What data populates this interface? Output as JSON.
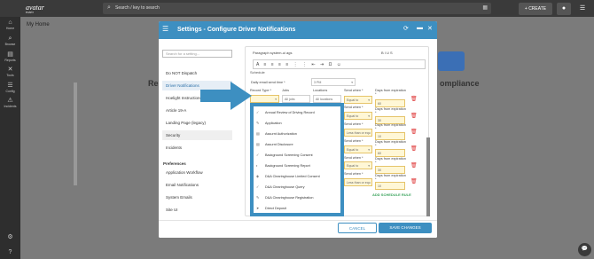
{
  "header": {
    "logo": "avatar",
    "logo_sub": "FLEET",
    "search_placeholder": "Search / key to search",
    "create_label": "+ CREATE"
  },
  "leftnav": [
    {
      "label": "Home",
      "icon": "⌂"
    },
    {
      "label": "Browse",
      "icon": "⌕"
    },
    {
      "label": "Reports",
      "icon": "▤"
    },
    {
      "label": "Tools",
      "icon": "✕"
    },
    {
      "label": "Config",
      "icon": "☰"
    },
    {
      "label": "Incidents",
      "icon": "⚠"
    }
  ],
  "page": {
    "title": "My Home",
    "bg_left": "Re",
    "bg_right": "ompliance"
  },
  "modal": {
    "title": "Settings - Configure Driver Notifications",
    "search_placeholder": "Search for a setting...",
    "side_items": [
      "Do NOT Dispatch",
      "Driver Notifications",
      "Hoelight Instructions",
      "Article 19-A",
      "Landing Page (legacy)",
      "Security",
      "Incidents"
    ],
    "prefs_heading": "Preferences",
    "pref_items": [
      "Application Workflow",
      "Email Notifications",
      "System Emails",
      "Site UI"
    ],
    "toolbar_text": "Paragraph    system-ui    ags",
    "schedule_label": "Schedule",
    "daily_label": "Daily email send time *",
    "daily_value": "3 PM",
    "col_record_type": "Record Type *",
    "col_jobs": "Jobs",
    "col_locations": "Locations",
    "col_send_when": "Send when *",
    "col_days": "Days from expiration *",
    "jobs_ph": "All jobs",
    "locations_ph": "All locations",
    "rows": [
      {
        "when": "Equal to",
        "days": "60"
      },
      {
        "when": "Equal to",
        "days": "30"
      },
      {
        "when": "Less than or equ",
        "days": "10"
      },
      {
        "when": "Equal to",
        "days": "60"
      },
      {
        "when": "Equal to",
        "days": "30"
      },
      {
        "when": "Less than or equ",
        "days": "10"
      }
    ],
    "add_rule": "ADD SCHEDULE RULE",
    "cancel": "CANCEL",
    "save": "SAVE CHANGES"
  },
  "dropdown": {
    "items": [
      {
        "label": "Annual Review of Driving Record",
        "icon": "✓"
      },
      {
        "label": "Application",
        "icon": "✎"
      },
      {
        "label": "Assurnt Authorization",
        "icon": "▤"
      },
      {
        "label": "Assurnt Disclosure",
        "icon": "▤"
      },
      {
        "label": "Background Screening Consent",
        "icon": "✓"
      },
      {
        "label": "Background Screening Report",
        "icon": "◐"
      },
      {
        "label": "D&A Clearinghouse Limited Consent",
        "icon": "◈"
      },
      {
        "label": "D&A Clearinghouse Query",
        "icon": "✓"
      },
      {
        "label": "D&A Clearinghouse Registration",
        "icon": "✎"
      },
      {
        "label": "Direct Deposit",
        "icon": "➤"
      }
    ]
  },
  "colors": {
    "accent": "#3d8fc1",
    "header": "#3a3a3a",
    "danger": "#dd3333",
    "success": "#3aa35c"
  }
}
